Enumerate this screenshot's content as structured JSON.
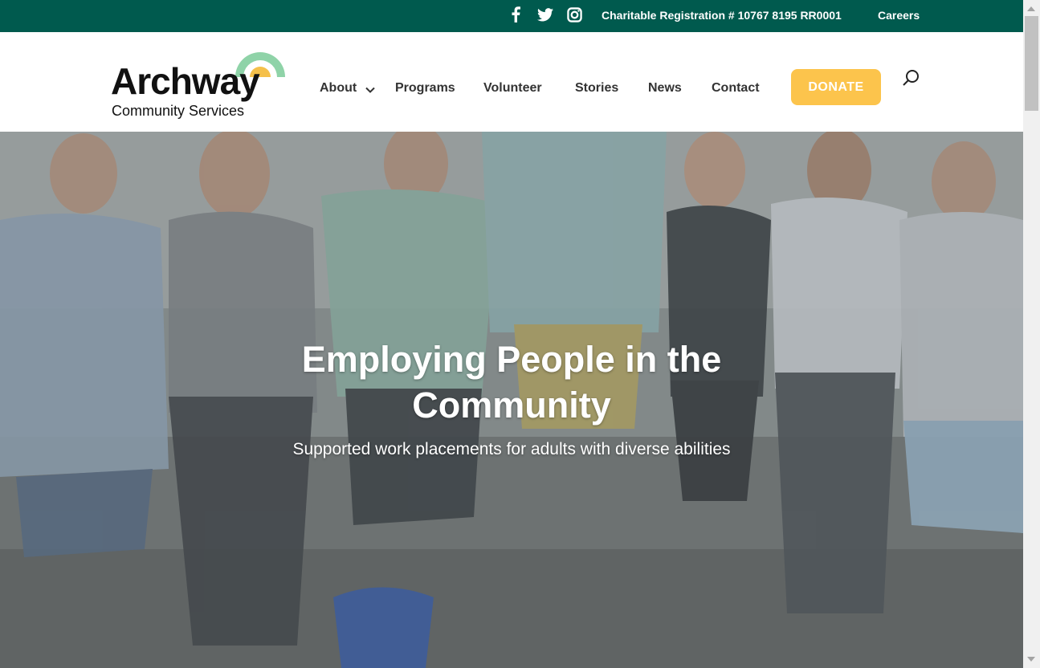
{
  "colors": {
    "topbar_bg": "#005a4e",
    "donate_bg": "#fcc44c",
    "logo_arc_outer": "#8fd3a8",
    "logo_arc_inner": "#f5c04a"
  },
  "topbar": {
    "social_icons": [
      "facebook-icon",
      "twitter-icon",
      "instagram-icon"
    ],
    "registration": "Charitable Registration # 10767 8195 RR0001",
    "careers": "Careers"
  },
  "logo": {
    "wordmark": "Archway",
    "subtitle": "Community Services"
  },
  "nav": {
    "items": [
      {
        "label": "About",
        "has_dropdown": true
      },
      {
        "label": "Programs"
      },
      {
        "label": "Volunteer"
      },
      {
        "label": "Stories"
      },
      {
        "label": "News"
      },
      {
        "label": "Contact"
      }
    ],
    "donate": "DONATE",
    "search_icon": "search-icon"
  },
  "hero": {
    "title": "Employing People in the Community",
    "subtitle": "Supported work placements for adults with diverse abilities"
  }
}
